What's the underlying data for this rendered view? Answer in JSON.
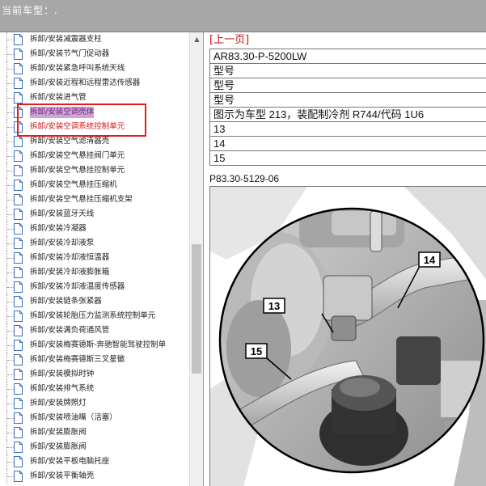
{
  "header": {
    "vehicle_label": "当前车型：."
  },
  "tree": {
    "items": [
      {
        "label": "拆卸/安装减震器支柱",
        "state": "normal"
      },
      {
        "label": "拆卸/安装节气门促动器",
        "state": "normal"
      },
      {
        "label": "拆卸/安装紧急呼叫系统天线",
        "state": "normal"
      },
      {
        "label": "拆卸/安装近程和远程雷达传感器",
        "state": "normal"
      },
      {
        "label": "拆卸/安装进气管",
        "state": "normal"
      },
      {
        "label": "拆卸/安装空调壳体",
        "state": "selected"
      },
      {
        "label": "拆卸/安装空调系统控制单元",
        "state": "red"
      },
      {
        "label": "拆卸/安装空气滤清器壳",
        "state": "normal"
      },
      {
        "label": "拆卸/安装空气悬挂阀门单元",
        "state": "normal"
      },
      {
        "label": "拆卸/安装空气悬挂控制单元",
        "state": "normal"
      },
      {
        "label": "拆卸/安装空气悬挂压缩机",
        "state": "normal"
      },
      {
        "label": "拆卸/安装空气悬挂压缩机支架",
        "state": "normal"
      },
      {
        "label": "拆卸/安装蓝牙天线",
        "state": "normal"
      },
      {
        "label": "拆卸/安装冷凝器",
        "state": "normal"
      },
      {
        "label": "拆卸/安装冷却液泵",
        "state": "normal"
      },
      {
        "label": "拆卸/安装冷却液恒温器",
        "state": "normal"
      },
      {
        "label": "拆卸/安装冷却液膨胀箱",
        "state": "normal"
      },
      {
        "label": "拆卸/安装冷却液温度传感器",
        "state": "normal"
      },
      {
        "label": "拆卸/安装链条张紧器",
        "state": "normal"
      },
      {
        "label": "拆卸/安装轮胎压力监测系统控制单元",
        "state": "normal"
      },
      {
        "label": "拆卸/安装满负荷通风管",
        "state": "normal"
      },
      {
        "label": "拆卸/安装梅赛德斯-奔驰智能驾驶控制单",
        "state": "normal"
      },
      {
        "label": "拆卸/安装梅赛德斯三叉星徽",
        "state": "normal"
      },
      {
        "label": "拆卸/安装模拟时钟",
        "state": "normal"
      },
      {
        "label": "拆卸/安装排气系统",
        "state": "normal"
      },
      {
        "label": "拆卸/安装牌照灯",
        "state": "normal"
      },
      {
        "label": "拆卸/安装喷油嘴（活塞）",
        "state": "normal"
      },
      {
        "label": "拆卸/安装膨胀阀",
        "state": "normal"
      },
      {
        "label": "拆卸/安装膨胀阀",
        "state": "normal"
      },
      {
        "label": "拆卸/安装平板电脑托座",
        "state": "normal"
      },
      {
        "label": "拆卸/安装平衡轴壳",
        "state": "normal"
      }
    ]
  },
  "content": {
    "prev_link": "[上一页]",
    "rows": [
      "AR83.30-P-5200LW",
      "型号",
      "型号",
      "型号",
      "图示为车型 213，装配制冷剂 R744/代码 1U6",
      "13",
      "14",
      "15"
    ],
    "figure_code": "P83.30-5129-06",
    "callouts": [
      "13",
      "14",
      "15"
    ]
  }
}
